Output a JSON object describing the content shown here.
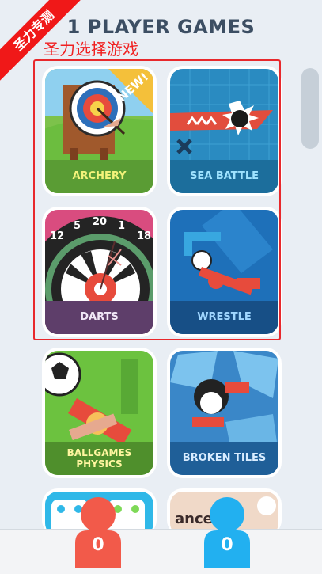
{
  "header": {
    "title": "1 PLAYER GAMES",
    "overlay_text": "圣力选择游戏",
    "corner_badge": "圣力专测"
  },
  "games": [
    {
      "name": "ARCHERY",
      "badge": "NEW!"
    },
    {
      "name": "SEA BATTLE"
    },
    {
      "name": "DARTS"
    },
    {
      "name": "WRESTLE"
    },
    {
      "name_line1": "BALLGAMES",
      "name_line2": "PHYSICS"
    },
    {
      "name": "BROKEN TILES"
    },
    {
      "name": ""
    },
    {
      "name": "ance"
    }
  ],
  "dart_numbers": [
    "12",
    "5",
    "20",
    "1",
    "18"
  ],
  "players": [
    {
      "score": "0",
      "color": "#f25a4a"
    },
    {
      "score": "0",
      "color": "#22b0f0"
    }
  ],
  "colors": {
    "title": "#3c4e63",
    "highlight": "#e8282c",
    "background": "#e9eef4"
  }
}
